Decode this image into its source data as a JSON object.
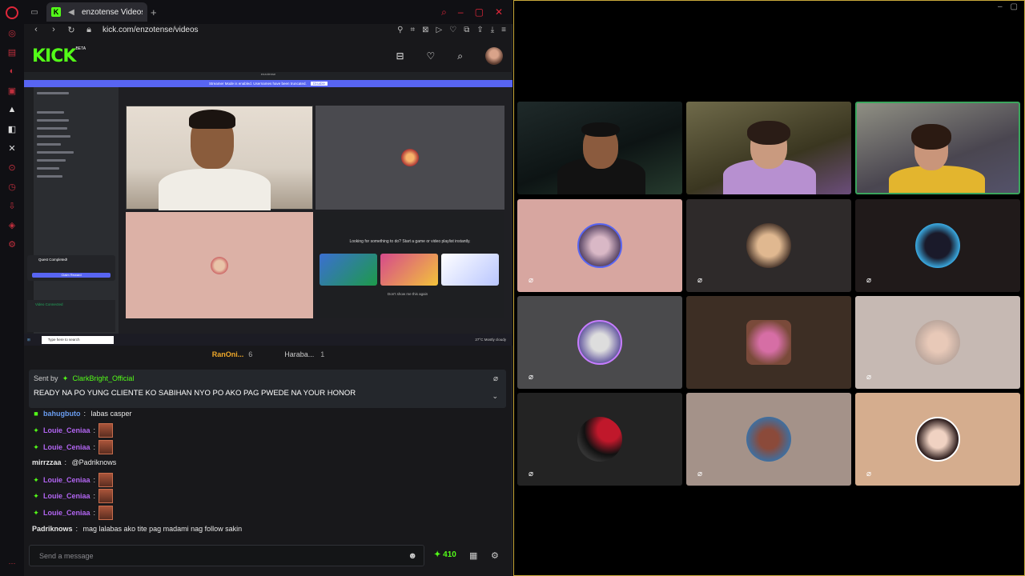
{
  "browser": {
    "tab_title": "enzotense Videos - Vi",
    "url": "kick.com/enzotense/videos",
    "logo_text": "KICK",
    "beta_label": "BETA"
  },
  "stream": {
    "discord_banner": "Streamer Mode is enabled. Usernames have been truncated.",
    "disable_label": "Disable",
    "server_name": "enzotense",
    "activity_title": "Looking for something to do? Start a game or video playlist instantly.",
    "activity_check": "Don't show me this again",
    "quest_title": "Quest Completed!",
    "quest_button": "Claim Reward",
    "voice_status": "Video Connected",
    "taskbar_search": "Type here to search",
    "taskbar_weather": "27°C Mostly cloudy"
  },
  "chat": {
    "tab_a_label": "RanOni...",
    "tab_a_count": "6",
    "tab_b_label": "Haraba...",
    "tab_b_count": "1",
    "pinned": {
      "sent_by_label": "Sent by",
      "sender": "ClarkBright_Official",
      "message": "READY NA PO YUNG CLIENTE KO SABIHAN NYO PO AKO PAG PWEDE NA YOUR HONOR"
    },
    "messages": [
      {
        "user": "bahugbuto",
        "text": "labas casper"
      },
      {
        "user": "Louie_Ceniaa",
        "text": ""
      },
      {
        "user": "Louie_Ceniaa",
        "text": ""
      },
      {
        "user": "mirrzzaa",
        "text": "@Padriknows"
      },
      {
        "user": "Louie_Ceniaa",
        "text": ""
      },
      {
        "user": "Louie_Ceniaa",
        "text": ""
      },
      {
        "user": "Louie_Ceniaa",
        "text": ""
      },
      {
        "user": "Padriknows",
        "text": "mag lalabas ako tite pag madami nag follow sakin"
      }
    ],
    "input_placeholder": "Send a message",
    "points": "410"
  },
  "icons": {
    "accent_kick": "#53fc18",
    "accent_opera": "#e0273a",
    "speaking_border": "#3ba55d"
  }
}
